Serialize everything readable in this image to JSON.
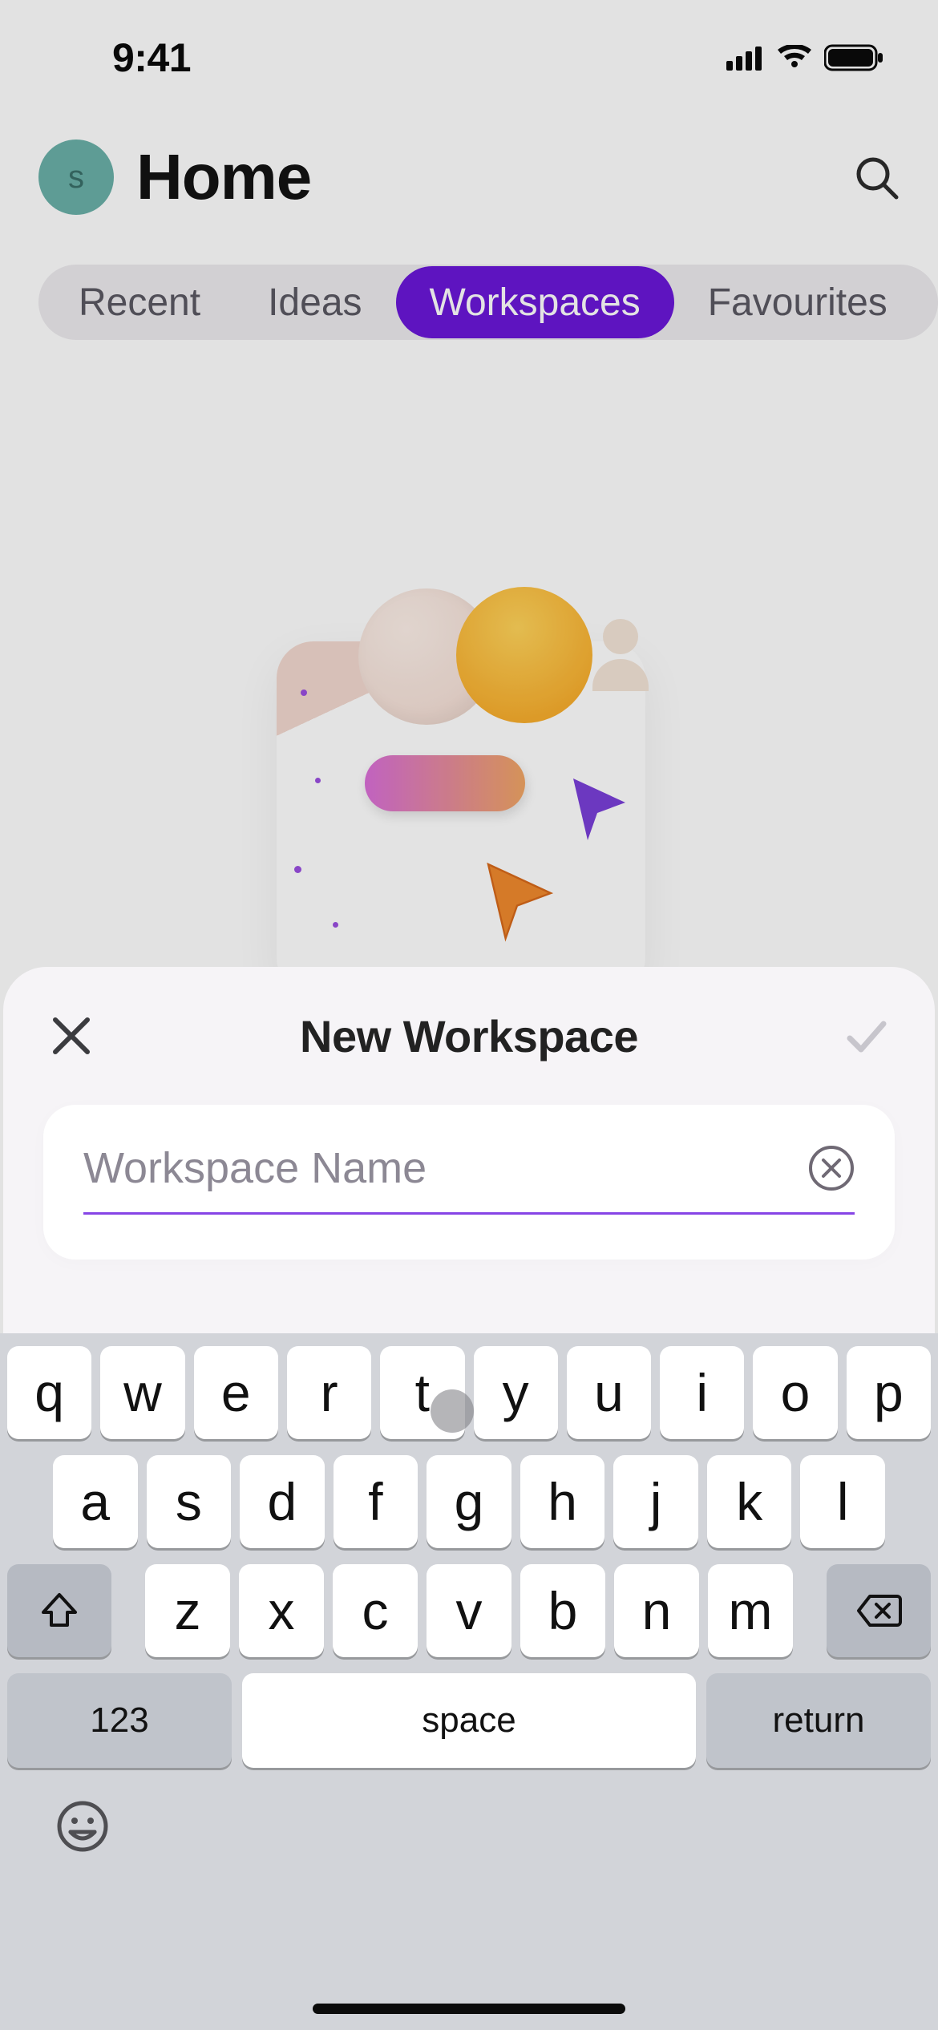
{
  "statusbar": {
    "time": "9:41"
  },
  "header": {
    "title": "Home",
    "avatar_initial": "s"
  },
  "tabs": {
    "items": [
      "Recent",
      "Ideas",
      "Workspaces",
      "Favourites"
    ],
    "active_index": 2
  },
  "sheet": {
    "title": "New Workspace",
    "input_value": "",
    "input_placeholder": "Workspace Name"
  },
  "keyboard": {
    "row1": [
      "q",
      "w",
      "e",
      "r",
      "t",
      "y",
      "u",
      "i",
      "o",
      "p"
    ],
    "row2": [
      "a",
      "s",
      "d",
      "f",
      "g",
      "h",
      "j",
      "k",
      "l"
    ],
    "row3": [
      "z",
      "x",
      "c",
      "v",
      "b",
      "n",
      "m"
    ],
    "numeric_label": "123",
    "space_label": "space",
    "return_label": "return"
  },
  "colors": {
    "accent": "#6a17d8"
  }
}
